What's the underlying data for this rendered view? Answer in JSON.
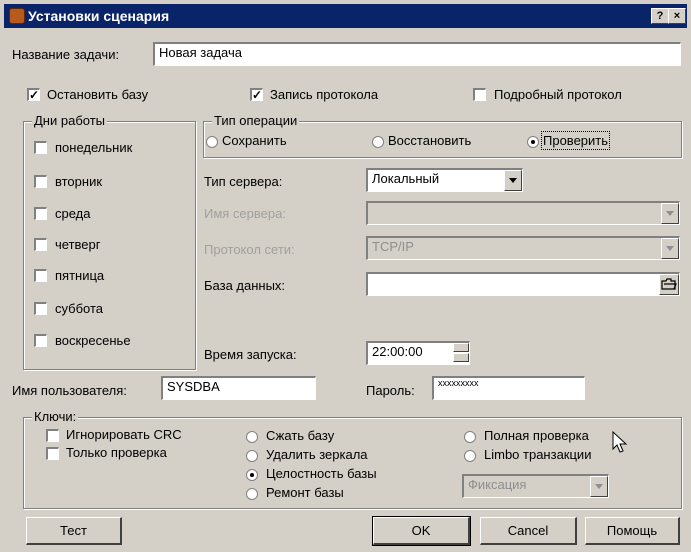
{
  "window": {
    "title": "Установки сценария",
    "help_btn": "?",
    "close_btn": "x"
  },
  "task_name": {
    "label": "Название задачи:",
    "value": "Новая задача"
  },
  "top_checks": {
    "stop_db": {
      "label": "Остановить базу",
      "checked": true
    },
    "write_log": {
      "label": "Запись протокола",
      "checked": true
    },
    "detailed_log": {
      "label": "Подробный протокол",
      "checked": false
    }
  },
  "days": {
    "title": "Дни работы",
    "items": [
      "понедельник",
      "вторник",
      "среда",
      "четверг",
      "пятница",
      "суббота",
      "воскресенье"
    ]
  },
  "operation": {
    "title": "Тип операции",
    "options": [
      "Сохранить",
      "Восстановить",
      "Проверить"
    ],
    "selected": "Проверить"
  },
  "server_type": {
    "label": "Тип сервера:",
    "value": "Локальный"
  },
  "server_name": {
    "label": "Имя сервера:",
    "value": ""
  },
  "protocol": {
    "label": "Протокол сети:",
    "value": "TCP/IP"
  },
  "database": {
    "label": "База данных:",
    "value": ""
  },
  "start_time": {
    "label": "Время запуска:",
    "value": "22:00:00"
  },
  "user": {
    "label": "Имя пользователя:",
    "value": "SYSDBA"
  },
  "password": {
    "label": "Пароль:",
    "value": "xxxxxxxxx"
  },
  "keys": {
    "title": "Ключи:",
    "checks": [
      "Игнорировать CRC",
      "Только проверка"
    ],
    "radios_col1": [
      "Сжать базу",
      "Удалить зеркала",
      "Целостность базы",
      "Ремонт базы"
    ],
    "radios_col1_selected": "Целостность базы",
    "radios_col2": [
      "Полная проверка",
      "Limbo транзакции"
    ],
    "fix_combo": "Фиксация"
  },
  "buttons": {
    "test": "Тест",
    "ok": "OK",
    "cancel": "Cancel",
    "help": "Помощь"
  },
  "colors": {
    "titlebar": "#0a246a",
    "face": "#d4d0c8"
  },
  "icons": {
    "app": "app-icon",
    "browse": "folder-icon"
  }
}
